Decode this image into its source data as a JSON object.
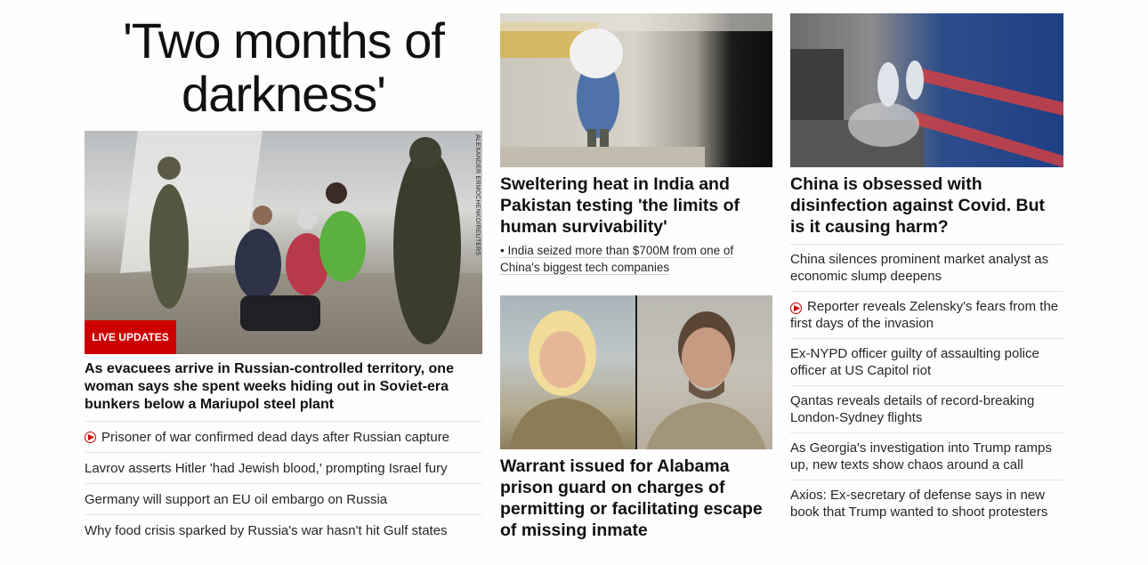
{
  "lead": {
    "title": "'Two months of darkness'",
    "photo_credit": "ALEXANDER ERMOCHENKO/REUTERS",
    "badge": "LIVE UPDATES",
    "headline": "As evacuees arrive in Russian-controlled territory, one woman says she spent weeks hiding out in Soviet-era bunkers below a Mariupol steel plant",
    "related": [
      {
        "text": "Prisoner of war confirmed dead days after Russian capture",
        "video": true
      },
      {
        "text": "Lavrov asserts Hitler 'had Jewish blood,' prompting Israel fury",
        "video": false
      },
      {
        "text": "Germany will support an EU oil embargo on Russia",
        "video": false
      },
      {
        "text": "Why food crisis sparked by Russia's war hasn't hit Gulf states",
        "video": false
      }
    ]
  },
  "middle": {
    "heat_headline": "Sweltering heat in India and Pakistan testing 'the limits of human survivability'",
    "heat_sub": "India seized more than $700M from one of China's biggest tech companies",
    "warrant_headline": "Warrant issued for Alabama prison guard on charges of permitting or facilitating escape of missing inmate"
  },
  "right": {
    "headline": "China is obsessed with disinfection against Covid. But is it causing harm?",
    "links": [
      {
        "text": "China silences prominent market analyst as economic slump deepens",
        "video": false
      },
      {
        "text": "Reporter reveals Zelensky's fears from the first days of the invasion",
        "video": true
      },
      {
        "text": "Ex-NYPD officer guilty of assaulting police officer at US Capitol riot",
        "video": false
      },
      {
        "text": "Qantas reveals details of record-breaking London-Sydney flights",
        "video": false
      },
      {
        "text": "As Georgia's investigation into Trump ramps up, new texts show chaos around a call",
        "video": false
      },
      {
        "text": "Axios: Ex-secretary of defense says in new book that Trump wanted to shoot protesters",
        "video": false
      }
    ]
  },
  "colors": {
    "accent": "#cc0000",
    "text": "#0c0c0c",
    "divider": "#e6e6e6"
  }
}
